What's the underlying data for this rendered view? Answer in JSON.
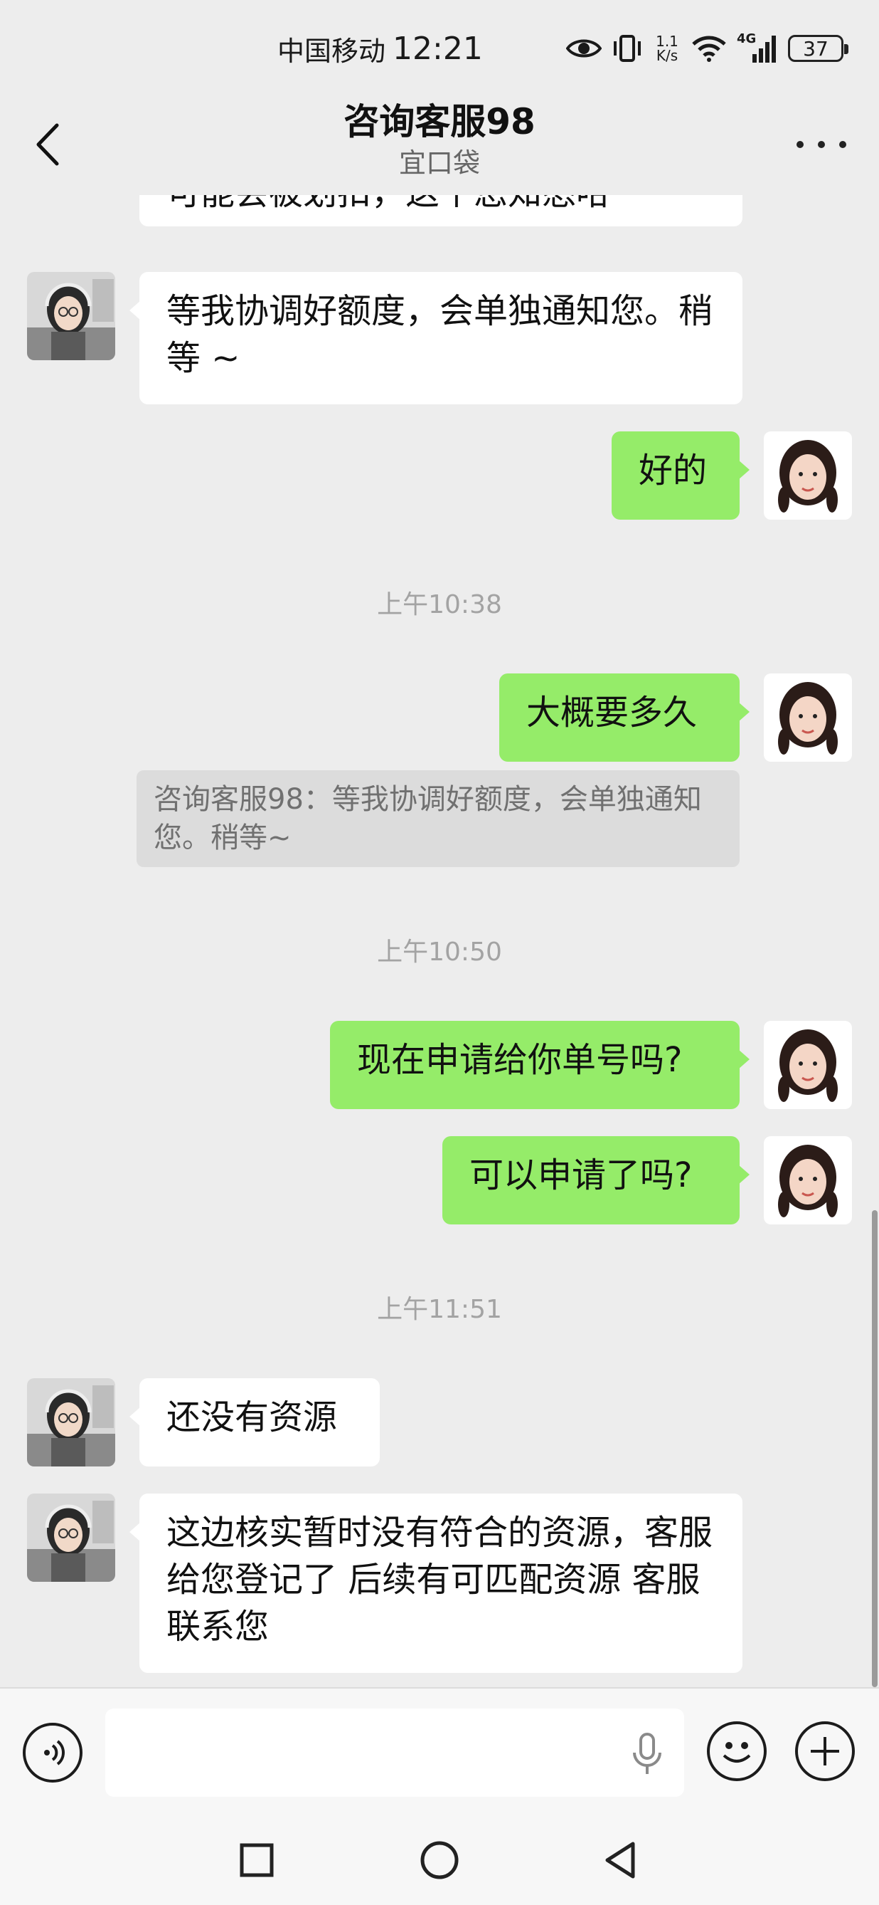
{
  "status_bar": {
    "carrier": "中国移动",
    "time": "12:21",
    "net_speed_value": "1.1",
    "net_speed_unit": "K/s",
    "network": "4G",
    "battery": "37"
  },
  "header": {
    "title": "咨询客服98",
    "subtitle": "宜口袋"
  },
  "messages": [
    {
      "side": "left",
      "text": "可能会被划扣，这个您知悉哈"
    },
    {
      "side": "left",
      "text": "等我协调好额度，会单独通知您。稍等 ~"
    },
    {
      "side": "right",
      "text": "好的"
    },
    {
      "type": "time",
      "text": "上午10:38"
    },
    {
      "side": "right",
      "text": "大概要多久"
    },
    {
      "type": "quote",
      "text": "咨询客服98：等我协调好额度，会单独通知您。稍等~"
    },
    {
      "type": "time",
      "text": "上午10:50"
    },
    {
      "side": "right",
      "text": "现在申请给你单号吗?"
    },
    {
      "side": "right",
      "text": "可以申请了吗?"
    },
    {
      "type": "time",
      "text": "上午11:51"
    },
    {
      "side": "left",
      "text": "还没有资源"
    },
    {
      "side": "left",
      "text": " 这边核实暂时没有符合的资源，客服给您登记了 后续有可匹配资源 客服联系您"
    }
  ],
  "icons": {
    "back": "chevron-left-icon",
    "more": "more-dots-icon",
    "voice": "voice-icon",
    "mic": "microphone-icon",
    "emoji": "emoji-icon",
    "add": "plus-icon",
    "nav_recent": "square-icon",
    "nav_home": "circle-icon",
    "nav_back": "triangle-back-icon"
  },
  "colors": {
    "background": "#ededed",
    "my_bubble": "#95ec69",
    "their_bubble": "#ffffff",
    "timestamp": "#a3a3a3"
  }
}
